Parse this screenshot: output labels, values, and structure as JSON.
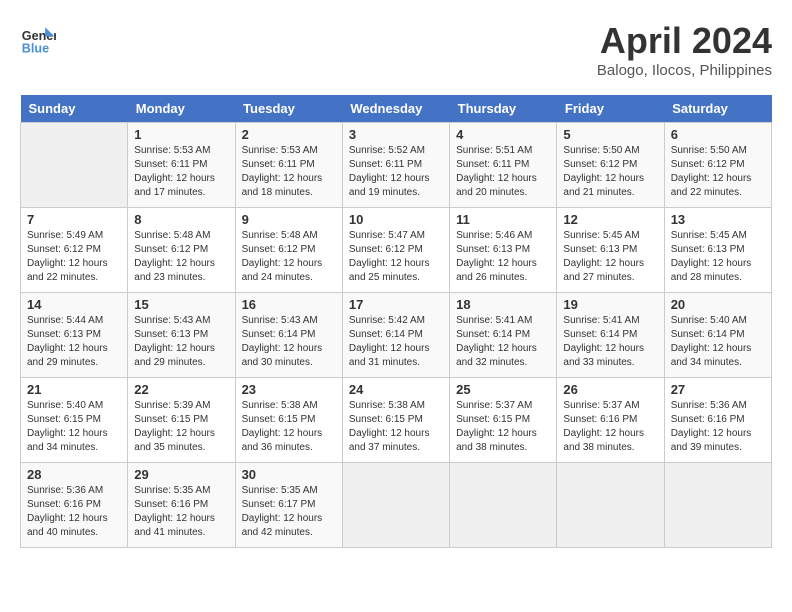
{
  "logo": {
    "line1": "General",
    "line2": "Blue"
  },
  "title": "April 2024",
  "location": "Balogo, Ilocos, Philippines",
  "days_of_week": [
    "Sunday",
    "Monday",
    "Tuesday",
    "Wednesday",
    "Thursday",
    "Friday",
    "Saturday"
  ],
  "weeks": [
    [
      {
        "day": "",
        "info": ""
      },
      {
        "day": "1",
        "info": "Sunrise: 5:53 AM\nSunset: 6:11 PM\nDaylight: 12 hours\nand 17 minutes."
      },
      {
        "day": "2",
        "info": "Sunrise: 5:53 AM\nSunset: 6:11 PM\nDaylight: 12 hours\nand 18 minutes."
      },
      {
        "day": "3",
        "info": "Sunrise: 5:52 AM\nSunset: 6:11 PM\nDaylight: 12 hours\nand 19 minutes."
      },
      {
        "day": "4",
        "info": "Sunrise: 5:51 AM\nSunset: 6:11 PM\nDaylight: 12 hours\nand 20 minutes."
      },
      {
        "day": "5",
        "info": "Sunrise: 5:50 AM\nSunset: 6:12 PM\nDaylight: 12 hours\nand 21 minutes."
      },
      {
        "day": "6",
        "info": "Sunrise: 5:50 AM\nSunset: 6:12 PM\nDaylight: 12 hours\nand 22 minutes."
      }
    ],
    [
      {
        "day": "7",
        "info": "Sunrise: 5:49 AM\nSunset: 6:12 PM\nDaylight: 12 hours\nand 22 minutes."
      },
      {
        "day": "8",
        "info": "Sunrise: 5:48 AM\nSunset: 6:12 PM\nDaylight: 12 hours\nand 23 minutes."
      },
      {
        "day": "9",
        "info": "Sunrise: 5:48 AM\nSunset: 6:12 PM\nDaylight: 12 hours\nand 24 minutes."
      },
      {
        "day": "10",
        "info": "Sunrise: 5:47 AM\nSunset: 6:12 PM\nDaylight: 12 hours\nand 25 minutes."
      },
      {
        "day": "11",
        "info": "Sunrise: 5:46 AM\nSunset: 6:13 PM\nDaylight: 12 hours\nand 26 minutes."
      },
      {
        "day": "12",
        "info": "Sunrise: 5:45 AM\nSunset: 6:13 PM\nDaylight: 12 hours\nand 27 minutes."
      },
      {
        "day": "13",
        "info": "Sunrise: 5:45 AM\nSunset: 6:13 PM\nDaylight: 12 hours\nand 28 minutes."
      }
    ],
    [
      {
        "day": "14",
        "info": "Sunrise: 5:44 AM\nSunset: 6:13 PM\nDaylight: 12 hours\nand 29 minutes."
      },
      {
        "day": "15",
        "info": "Sunrise: 5:43 AM\nSunset: 6:13 PM\nDaylight: 12 hours\nand 29 minutes."
      },
      {
        "day": "16",
        "info": "Sunrise: 5:43 AM\nSunset: 6:14 PM\nDaylight: 12 hours\nand 30 minutes."
      },
      {
        "day": "17",
        "info": "Sunrise: 5:42 AM\nSunset: 6:14 PM\nDaylight: 12 hours\nand 31 minutes."
      },
      {
        "day": "18",
        "info": "Sunrise: 5:41 AM\nSunset: 6:14 PM\nDaylight: 12 hours\nand 32 minutes."
      },
      {
        "day": "19",
        "info": "Sunrise: 5:41 AM\nSunset: 6:14 PM\nDaylight: 12 hours\nand 33 minutes."
      },
      {
        "day": "20",
        "info": "Sunrise: 5:40 AM\nSunset: 6:14 PM\nDaylight: 12 hours\nand 34 minutes."
      }
    ],
    [
      {
        "day": "21",
        "info": "Sunrise: 5:40 AM\nSunset: 6:15 PM\nDaylight: 12 hours\nand 34 minutes."
      },
      {
        "day": "22",
        "info": "Sunrise: 5:39 AM\nSunset: 6:15 PM\nDaylight: 12 hours\nand 35 minutes."
      },
      {
        "day": "23",
        "info": "Sunrise: 5:38 AM\nSunset: 6:15 PM\nDaylight: 12 hours\nand 36 minutes."
      },
      {
        "day": "24",
        "info": "Sunrise: 5:38 AM\nSunset: 6:15 PM\nDaylight: 12 hours\nand 37 minutes."
      },
      {
        "day": "25",
        "info": "Sunrise: 5:37 AM\nSunset: 6:15 PM\nDaylight: 12 hours\nand 38 minutes."
      },
      {
        "day": "26",
        "info": "Sunrise: 5:37 AM\nSunset: 6:16 PM\nDaylight: 12 hours\nand 38 minutes."
      },
      {
        "day": "27",
        "info": "Sunrise: 5:36 AM\nSunset: 6:16 PM\nDaylight: 12 hours\nand 39 minutes."
      }
    ],
    [
      {
        "day": "28",
        "info": "Sunrise: 5:36 AM\nSunset: 6:16 PM\nDaylight: 12 hours\nand 40 minutes."
      },
      {
        "day": "29",
        "info": "Sunrise: 5:35 AM\nSunset: 6:16 PM\nDaylight: 12 hours\nand 41 minutes."
      },
      {
        "day": "30",
        "info": "Sunrise: 5:35 AM\nSunset: 6:17 PM\nDaylight: 12 hours\nand 42 minutes."
      },
      {
        "day": "",
        "info": ""
      },
      {
        "day": "",
        "info": ""
      },
      {
        "day": "",
        "info": ""
      },
      {
        "day": "",
        "info": ""
      }
    ]
  ]
}
